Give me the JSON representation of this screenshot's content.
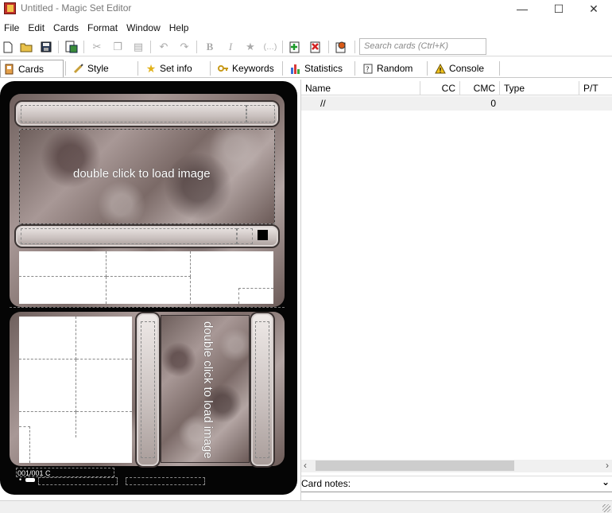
{
  "window": {
    "title": "Untitled - Magic Set Editor",
    "minimize": "—",
    "maximize": "☐",
    "close": "✕"
  },
  "menu": [
    "File",
    "Edit",
    "Cards",
    "Format",
    "Window",
    "Help"
  ],
  "search": {
    "placeholder": "Search cards (Ctrl+K)"
  },
  "tabs": [
    {
      "label": "Cards",
      "icon": "cards-icon",
      "active": true
    },
    {
      "label": "Style",
      "icon": "brush-icon"
    },
    {
      "label": "Set info",
      "icon": "star-icon"
    },
    {
      "label": "Keywords",
      "icon": "key-icon"
    },
    {
      "label": "Statistics",
      "icon": "bar-chart-icon"
    },
    {
      "label": "Random",
      "icon": "random-icon"
    },
    {
      "label": "Console",
      "icon": "warning-icon"
    }
  ],
  "card": {
    "top_image_text": "double click to load image",
    "side_image_text": "double click to load image",
    "collector": "001/001 C",
    "bullet": "•"
  },
  "list": {
    "columns": [
      "Name",
      "CC",
      "CMC",
      "Type",
      "P/T"
    ],
    "rows": [
      {
        "name": "//",
        "cc": "",
        "cmc": "0",
        "type": "",
        "pt": ""
      }
    ]
  },
  "notes_label": "Card notes:"
}
